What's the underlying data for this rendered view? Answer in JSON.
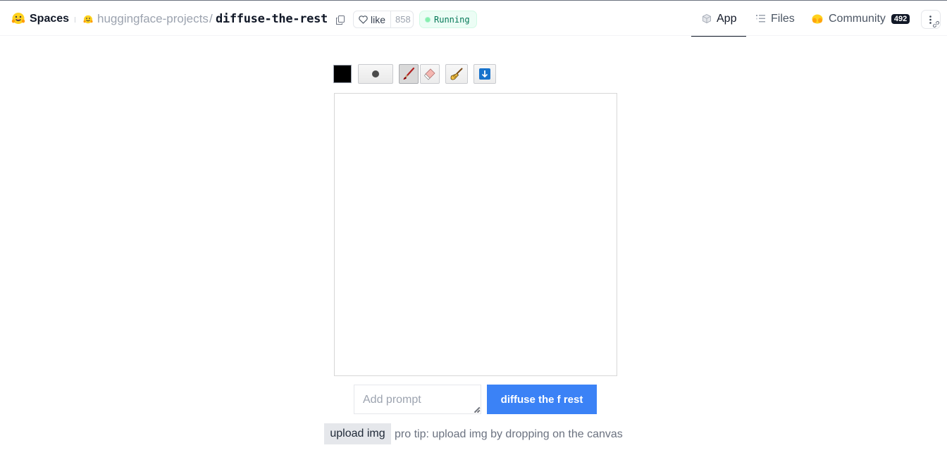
{
  "header": {
    "spaces_label": "Spaces",
    "org": "huggingface-projects",
    "separator": "/",
    "repo": "diffuse-the-rest",
    "like": {
      "label": "like",
      "count": "858"
    },
    "status": "Running",
    "tabs": [
      {
        "label": "App",
        "icon": "cube-icon",
        "active": true
      },
      {
        "label": "Files",
        "icon": "files-icon",
        "active": false
      },
      {
        "label": "Community",
        "icon": "community-icon",
        "badge": "492",
        "active": false
      }
    ]
  },
  "toolbar": {
    "color": "#000000",
    "tools": [
      {
        "name": "brush",
        "icon": "paintbrush-icon",
        "selected": true
      },
      {
        "name": "eraser",
        "icon": "eraser-icon",
        "selected": false
      },
      {
        "name": "clear",
        "icon": "broom-icon",
        "selected": false
      },
      {
        "name": "download",
        "icon": "download-icon",
        "selected": false
      }
    ]
  },
  "prompt": {
    "placeholder": "Add prompt",
    "value": "",
    "submit_label": "diffuse the f rest"
  },
  "upload": {
    "button_label": "upload img",
    "tip": "pro tip: upload img by dropping on the canvas"
  },
  "colors": {
    "accent": "#3b82f6",
    "status_bg": "#ecfdf5",
    "status_text": "#047857"
  }
}
